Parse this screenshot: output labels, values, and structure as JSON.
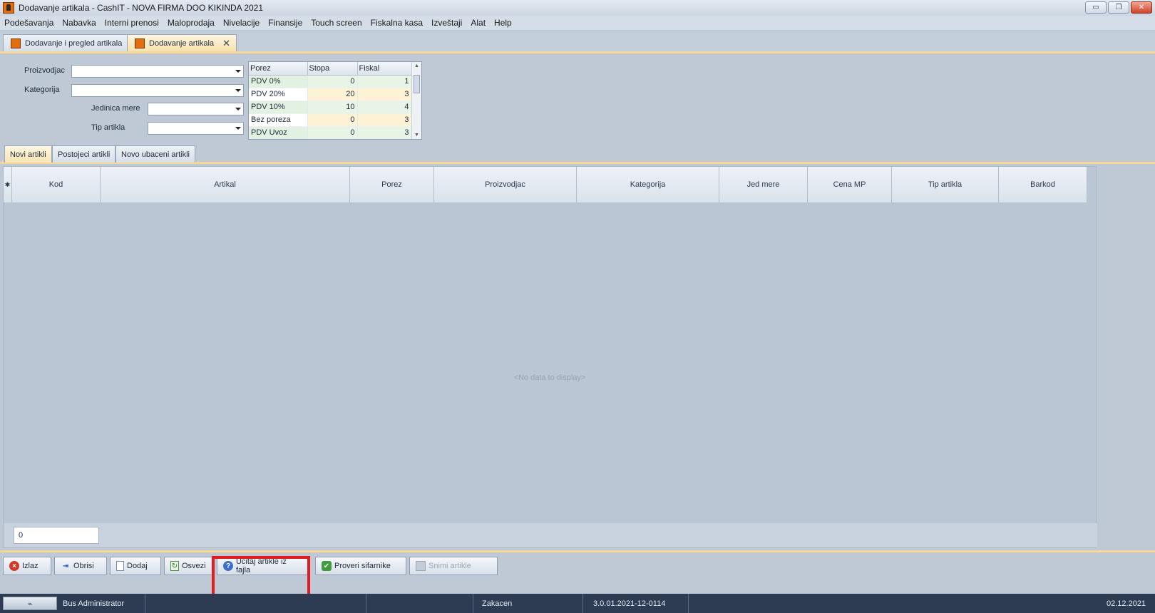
{
  "window": {
    "title": "Dodavanje artikala - CashIT - NOVA FIRMA DOO KIKINDA 2021",
    "buttons": {
      "minimize": "▭",
      "restore": "❐",
      "close": "✕"
    }
  },
  "menu": [
    "Podešavanja",
    "Nabavka",
    "Interni prenosi",
    "Maloprodaja",
    "Nivelacije",
    "Finansije",
    "Touch screen",
    "Fiskalna kasa",
    "Izveštaji",
    "Alat",
    "Help"
  ],
  "doc_tabs": [
    {
      "label": "Dodavanje i pregled artikala",
      "active": false
    },
    {
      "label": "Dodavanje artikala",
      "active": true,
      "close": "✕"
    }
  ],
  "form": {
    "proizvodjac_label": "Proizvodjac",
    "kategorija_label": "Kategorija",
    "jedinica_mere_label": "Jedinica mere",
    "tip_artikla_label": "Tip artikla",
    "proizvodjac_value": "",
    "kategorija_value": "",
    "jedinica_mere_value": "",
    "tip_artikla_value": ""
  },
  "tax_grid": {
    "headers": [
      "Porez",
      "Stopa",
      "Fiskal"
    ],
    "rows": [
      {
        "porez": "PDV 0%",
        "stopa": "0",
        "fiskal": "1"
      },
      {
        "porez": "PDV 20%",
        "stopa": "20",
        "fiskal": "3"
      },
      {
        "porez": "PDV 10%",
        "stopa": "10",
        "fiskal": "4"
      },
      {
        "porez": "Bez poreza",
        "stopa": "0",
        "fiskal": "3"
      },
      {
        "porez": "PDV Uvoz",
        "stopa": "0",
        "fiskal": "3"
      }
    ]
  },
  "inner_tabs": [
    "Novi artikli",
    "Postojeci artikli",
    "Novo ubaceni artikli"
  ],
  "grid": {
    "indicator": "✱",
    "columns": [
      "Kod",
      "Artikal",
      "Porez",
      "Proizvodjac",
      "Kategorija",
      "Jed mere",
      "Cena MP",
      "Tip artikla",
      "Barkod"
    ],
    "empty_text": "<No data to display>",
    "footer_count": "0"
  },
  "toolbar": {
    "izlaz": "Izlaz",
    "obrisi": "Obrisi",
    "dodaj": "Dodaj",
    "osvezi": "Osvezi",
    "ucitaj": "Ucitaj artikle iz fajla",
    "proveri": "Proveri sifarnike",
    "snimi": "Snimi artikle"
  },
  "status": {
    "user": "Bus Administrator",
    "state": "Zakacen",
    "version": "3.0.01.2021-12-0114",
    "date": "02.12.2021"
  },
  "colors": {
    "highlight": "#e21b22",
    "tab_accent": "#f7d793",
    "statusbar": "#2d3c53"
  }
}
